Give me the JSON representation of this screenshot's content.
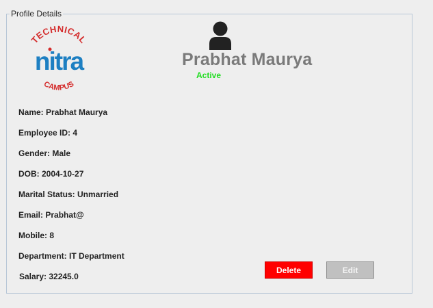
{
  "panel": {
    "title": "Profile Details"
  },
  "logo": {
    "top_text": "TECHNICAL",
    "brand": "nitra",
    "bottom_text": "CAMPUS"
  },
  "profile": {
    "name": "Prabhat Maurya",
    "status": "Active"
  },
  "details": [
    {
      "label": "Name: Prabhat Maurya"
    },
    {
      "label": "Employee ID: 4"
    },
    {
      "label": "Gender: Male"
    },
    {
      "label": "DOB: 2004-10-27"
    },
    {
      "label": "Marital Status: Unmarried"
    },
    {
      "label": "Email: Prabhat@"
    },
    {
      "label": "Mobile: 8"
    },
    {
      "label": "Department: IT Department"
    },
    {
      "label": "Salary: 32245.0"
    }
  ],
  "actions": {
    "delete_label": "Delete",
    "edit_label": "Edit"
  },
  "colors": {
    "background": "#eeeeee",
    "delete": "#ff0000",
    "edit": "#c0c0c0",
    "status_active": "#22dd22",
    "logo_red": "#d42a2a",
    "logo_blue": "#1d7fc2"
  },
  "icons": {
    "avatar": "user-avatar-icon"
  }
}
